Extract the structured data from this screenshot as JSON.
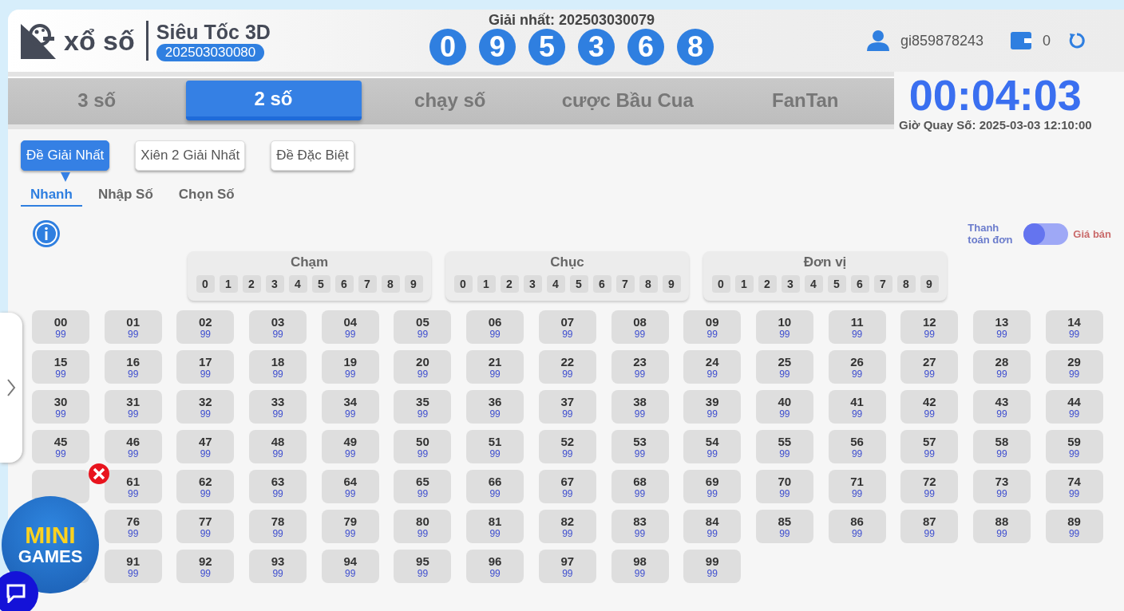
{
  "header": {
    "brand": "xổ số",
    "game": "Siêu Tốc 3D",
    "period": "202503030080",
    "last_result": {
      "label": "Giải nhất: 202503030079",
      "balls": [
        "0",
        "9",
        "5",
        "3",
        "6",
        "8"
      ]
    },
    "username": "gi859878243",
    "balance": "0"
  },
  "tabs": [
    {
      "label": "3 số",
      "selected": false
    },
    {
      "label": "2 số",
      "selected": true
    },
    {
      "label": "chạy số",
      "selected": false
    },
    {
      "label": "cược Bầu Cua",
      "selected": false
    },
    {
      "label": "FanTan",
      "selected": false
    }
  ],
  "countdown": {
    "time": "00:04:03",
    "draw_time": "Giờ Quay Số: 2025-03-03 12:10:00"
  },
  "bet_types": [
    {
      "label": "Đề Giải Nhất",
      "selected": true
    },
    {
      "label": "Xiên 2 Giải Nhất",
      "selected": false
    },
    {
      "label": "Đề Đặc Biệt",
      "selected": false
    }
  ],
  "modes": [
    {
      "label": "Nhanh",
      "selected": true
    },
    {
      "label": "Nhập Số",
      "selected": false
    },
    {
      "label": "Chọn Số",
      "selected": false
    }
  ],
  "price_toggle": {
    "left_label": "Thanh toán đơn",
    "right_label": "Giá bán",
    "on": false
  },
  "digit_groups": [
    {
      "title": "Chạm",
      "digits": [
        "0",
        "1",
        "2",
        "3",
        "4",
        "5",
        "6",
        "7",
        "8",
        "9"
      ]
    },
    {
      "title": "Chục",
      "digits": [
        "0",
        "1",
        "2",
        "3",
        "4",
        "5",
        "6",
        "7",
        "8",
        "9"
      ]
    },
    {
      "title": "Đơn vị",
      "digits": [
        "0",
        "1",
        "2",
        "3",
        "4",
        "5",
        "6",
        "7",
        "8",
        "9"
      ]
    }
  ],
  "cells": [
    {
      "kind": "number",
      "number": "00",
      "odds": "99"
    },
    {
      "kind": "number",
      "number": "01",
      "odds": "99"
    },
    {
      "kind": "number",
      "number": "02",
      "odds": "99"
    },
    {
      "kind": "number",
      "number": "03",
      "odds": "99"
    },
    {
      "kind": "number",
      "number": "04",
      "odds": "99"
    },
    {
      "kind": "number",
      "number": "05",
      "odds": "99"
    },
    {
      "kind": "number",
      "number": "06",
      "odds": "99"
    },
    {
      "kind": "number",
      "number": "07",
      "odds": "99"
    },
    {
      "kind": "number",
      "number": "08",
      "odds": "99"
    },
    {
      "kind": "number",
      "number": "09",
      "odds": "99"
    },
    {
      "kind": "number",
      "number": "10",
      "odds": "99"
    },
    {
      "kind": "number",
      "number": "11",
      "odds": "99"
    },
    {
      "kind": "number",
      "number": "12",
      "odds": "99"
    },
    {
      "kind": "number",
      "number": "13",
      "odds": "99"
    },
    {
      "kind": "number",
      "number": "14",
      "odds": "99"
    },
    {
      "kind": "number",
      "number": "15",
      "odds": "99"
    },
    {
      "kind": "number",
      "number": "16",
      "odds": "99"
    },
    {
      "kind": "number",
      "number": "17",
      "odds": "99"
    },
    {
      "kind": "number",
      "number": "18",
      "odds": "99"
    },
    {
      "kind": "number",
      "number": "19",
      "odds": "99"
    },
    {
      "kind": "number",
      "number": "20",
      "odds": "99"
    },
    {
      "kind": "number",
      "number": "21",
      "odds": "99"
    },
    {
      "kind": "number",
      "number": "22",
      "odds": "99"
    },
    {
      "kind": "number",
      "number": "23",
      "odds": "99"
    },
    {
      "kind": "number",
      "number": "24",
      "odds": "99"
    },
    {
      "kind": "number",
      "number": "25",
      "odds": "99"
    },
    {
      "kind": "number",
      "number": "26",
      "odds": "99"
    },
    {
      "kind": "number",
      "number": "27",
      "odds": "99"
    },
    {
      "kind": "number",
      "number": "28",
      "odds": "99"
    },
    {
      "kind": "number",
      "number": "29",
      "odds": "99"
    },
    {
      "kind": "number",
      "number": "30",
      "odds": "99"
    },
    {
      "kind": "number",
      "number": "31",
      "odds": "99"
    },
    {
      "kind": "number",
      "number": "32",
      "odds": "99"
    },
    {
      "kind": "number",
      "number": "33",
      "odds": "99"
    },
    {
      "kind": "number",
      "number": "34",
      "odds": "99"
    },
    {
      "kind": "number",
      "number": "35",
      "odds": "99"
    },
    {
      "kind": "number",
      "number": "36",
      "odds": "99"
    },
    {
      "kind": "number",
      "number": "37",
      "odds": "99"
    },
    {
      "kind": "number",
      "number": "38",
      "odds": "99"
    },
    {
      "kind": "number",
      "number": "39",
      "odds": "99"
    },
    {
      "kind": "number",
      "number": "40",
      "odds": "99"
    },
    {
      "kind": "number",
      "number": "41",
      "odds": "99"
    },
    {
      "kind": "number",
      "number": "42",
      "odds": "99"
    },
    {
      "kind": "number",
      "number": "43",
      "odds": "99"
    },
    {
      "kind": "number",
      "number": "44",
      "odds": "99"
    },
    {
      "kind": "number",
      "number": "45",
      "odds": "99"
    },
    {
      "kind": "number",
      "number": "46",
      "odds": "99"
    },
    {
      "kind": "number",
      "number": "47",
      "odds": "99"
    },
    {
      "kind": "number",
      "number": "48",
      "odds": "99"
    },
    {
      "kind": "number",
      "number": "49",
      "odds": "99"
    },
    {
      "kind": "number",
      "number": "50",
      "odds": "99"
    },
    {
      "kind": "number",
      "number": "51",
      "odds": "99"
    },
    {
      "kind": "number",
      "number": "52",
      "odds": "99"
    },
    {
      "kind": "number",
      "number": "53",
      "odds": "99"
    },
    {
      "kind": "number",
      "number": "54",
      "odds": "99"
    },
    {
      "kind": "number",
      "number": "55",
      "odds": "99"
    },
    {
      "kind": "number",
      "number": "56",
      "odds": "99"
    },
    {
      "kind": "number",
      "number": "57",
      "odds": "99"
    },
    {
      "kind": "number",
      "number": "58",
      "odds": "99"
    },
    {
      "kind": "number",
      "number": "59",
      "odds": "99"
    },
    {
      "kind": "covered"
    },
    {
      "kind": "number",
      "number": "61",
      "odds": "99"
    },
    {
      "kind": "number",
      "number": "62",
      "odds": "99"
    },
    {
      "kind": "number",
      "number": "63",
      "odds": "99"
    },
    {
      "kind": "number",
      "number": "64",
      "odds": "99"
    },
    {
      "kind": "number",
      "number": "65",
      "odds": "99"
    },
    {
      "kind": "number",
      "number": "66",
      "odds": "99"
    },
    {
      "kind": "number",
      "number": "67",
      "odds": "99"
    },
    {
      "kind": "number",
      "number": "68",
      "odds": "99"
    },
    {
      "kind": "number",
      "number": "69",
      "odds": "99"
    },
    {
      "kind": "number",
      "number": "70",
      "odds": "99"
    },
    {
      "kind": "number",
      "number": "71",
      "odds": "99"
    },
    {
      "kind": "number",
      "number": "72",
      "odds": "99"
    },
    {
      "kind": "number",
      "number": "73",
      "odds": "99"
    },
    {
      "kind": "number",
      "number": "74",
      "odds": "99"
    },
    {
      "kind": "covered"
    },
    {
      "kind": "number",
      "number": "76",
      "odds": "99"
    },
    {
      "kind": "number",
      "number": "77",
      "odds": "99"
    },
    {
      "kind": "number",
      "number": "78",
      "odds": "99"
    },
    {
      "kind": "number",
      "number": "79",
      "odds": "99"
    },
    {
      "kind": "number",
      "number": "80",
      "odds": "99"
    },
    {
      "kind": "number",
      "number": "81",
      "odds": "99"
    },
    {
      "kind": "number",
      "number": "82",
      "odds": "99"
    },
    {
      "kind": "number",
      "number": "83",
      "odds": "99"
    },
    {
      "kind": "number",
      "number": "84",
      "odds": "99"
    },
    {
      "kind": "number",
      "number": "85",
      "odds": "99"
    },
    {
      "kind": "number",
      "number": "86",
      "odds": "99"
    },
    {
      "kind": "number",
      "number": "87",
      "odds": "99"
    },
    {
      "kind": "number",
      "number": "88",
      "odds": "99"
    },
    {
      "kind": "number",
      "number": "89",
      "odds": "99"
    },
    {
      "kind": "covered"
    },
    {
      "kind": "number",
      "number": "91",
      "odds": "99"
    },
    {
      "kind": "number",
      "number": "92",
      "odds": "99"
    },
    {
      "kind": "number",
      "number": "93",
      "odds": "99"
    },
    {
      "kind": "number",
      "number": "94",
      "odds": "99"
    },
    {
      "kind": "number",
      "number": "95",
      "odds": "99"
    },
    {
      "kind": "number",
      "number": "96",
      "odds": "99"
    },
    {
      "kind": "number",
      "number": "97",
      "odds": "99"
    },
    {
      "kind": "number",
      "number": "98",
      "odds": "99"
    },
    {
      "kind": "number",
      "number": "99",
      "odds": "99"
    }
  ],
  "mini_games": {
    "line1": "MINI",
    "line2": "GAMES"
  }
}
